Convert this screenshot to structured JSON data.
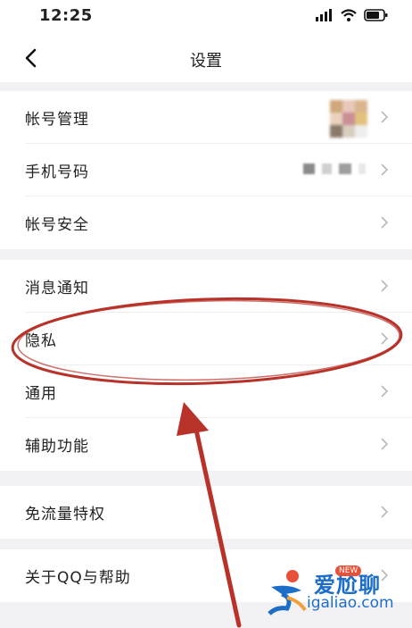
{
  "status_bar": {
    "time": "12:25"
  },
  "header": {
    "title": "设置"
  },
  "groups": [
    {
      "items": [
        {
          "label": "帐号管理"
        },
        {
          "label": "手机号码"
        },
        {
          "label": "帐号安全"
        }
      ]
    },
    {
      "items": [
        {
          "label": "消息通知"
        },
        {
          "label": "隐私"
        },
        {
          "label": "通用"
        },
        {
          "label": "辅助功能"
        }
      ]
    },
    {
      "items": [
        {
          "label": "免流量特权"
        }
      ]
    },
    {
      "items": [
        {
          "label": "关于QQ与帮助"
        }
      ]
    }
  ],
  "annotation": {
    "color": "#b8322a",
    "highlighted_item": "隐私"
  },
  "watermark": {
    "brand": "爱尬聊",
    "badge": "NEW",
    "url": "igaliao.com",
    "color": "#1e6ec8"
  }
}
